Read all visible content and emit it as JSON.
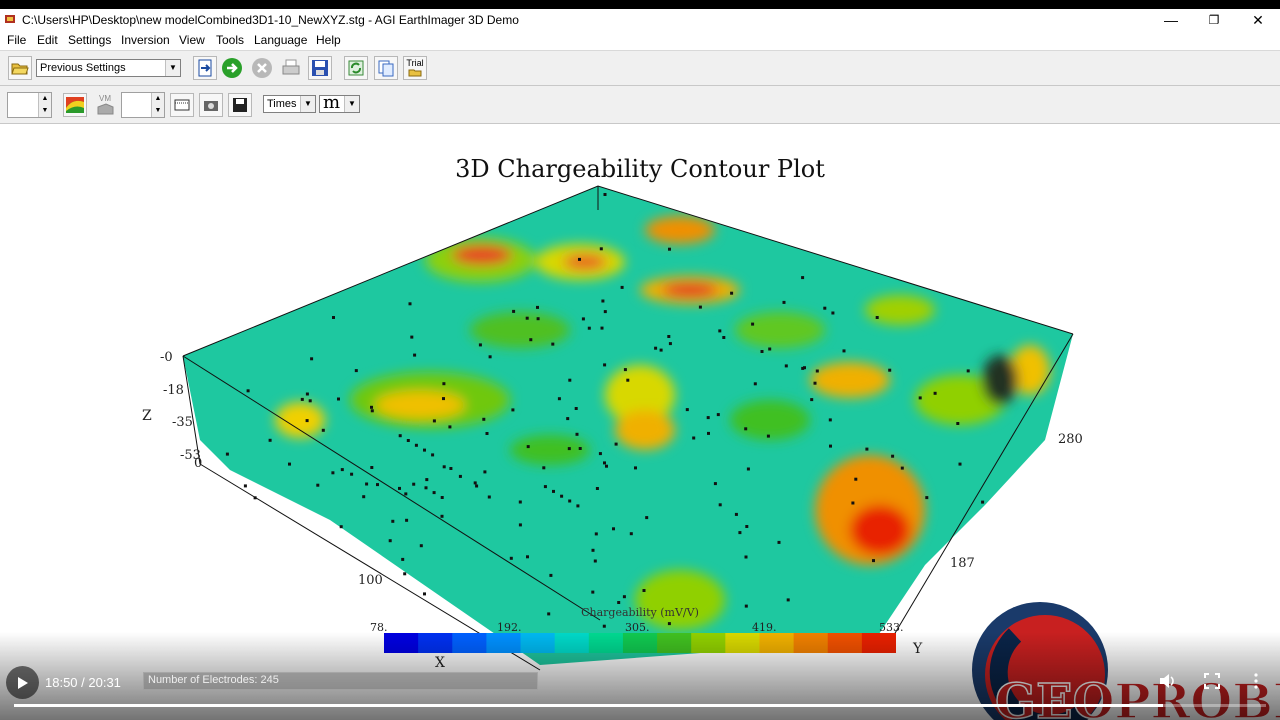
{
  "window": {
    "title": "C:\\Users\\HP\\Desktop\\new modelCombined3D1-10_NewXYZ.stg - AGI EarthImager 3D Demo"
  },
  "menu": [
    "File",
    "Edit",
    "Settings",
    "Inversion",
    "View",
    "Tools",
    "Language",
    "Help"
  ],
  "toolbar": {
    "settings_combo": "Previous Settings",
    "trial_label": "Trial",
    "vm_label": "VM",
    "font_combo": "Times",
    "unit_combo": "m"
  },
  "plot": {
    "title": "3D Chargeability Contour Plot",
    "z_label": "Z",
    "x_label": "X",
    "y_label": "Y",
    "z_ticks": [
      "-0",
      "-18",
      "-35",
      "-53"
    ],
    "x_ticks": [
      "0",
      "100"
    ],
    "y_ticks": [
      "187",
      "280"
    ]
  },
  "colorbar": {
    "title": "Chargeability (mV/V)",
    "ticks": [
      "78.",
      "192.",
      "305.",
      "419.",
      "533."
    ],
    "colors": [
      "#0000e0",
      "#0030f0",
      "#0060ff",
      "#0090ff",
      "#00b8f0",
      "#00d8c8",
      "#00d890",
      "#10c850",
      "#40c020",
      "#90d000",
      "#d8d800",
      "#f0b000",
      "#f08000",
      "#f05000",
      "#e82000"
    ]
  },
  "video": {
    "time": "18:50 / 20:31",
    "progress": 0.918
  },
  "status": {
    "text": "Number of Electrodes: 245"
  }
}
